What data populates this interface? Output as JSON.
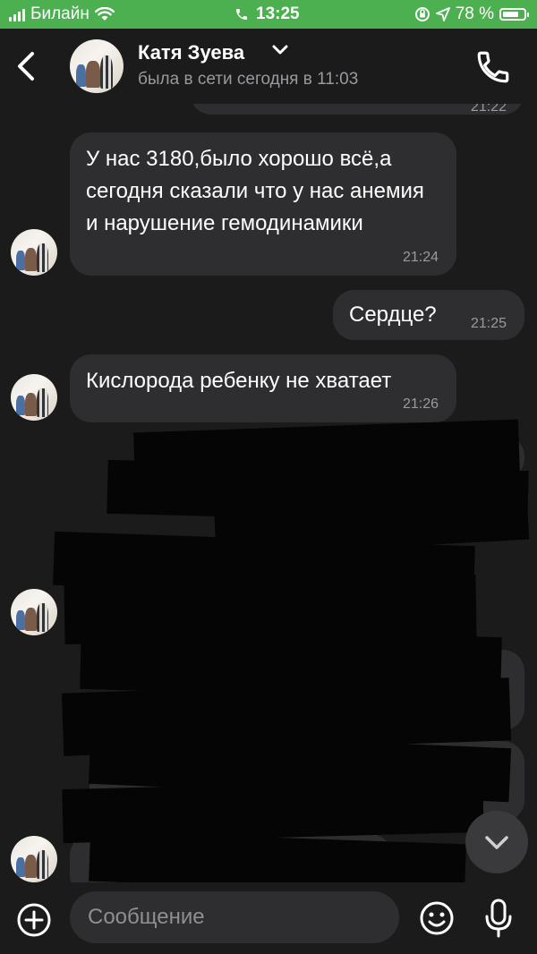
{
  "status_bar": {
    "carrier": "Билайн",
    "time": "13:25",
    "battery": "78 %",
    "battery_level": 0.78
  },
  "header": {
    "contact_name": "Катя Зуева",
    "last_seen": "была в сети сегодня в 11:03",
    "icons": [
      "back-arrow-icon",
      "chevron-down-icon",
      "phone-icon"
    ]
  },
  "messages": [
    {
      "direction": "outgoing",
      "text": "",
      "time": "21:22",
      "partially_visible": true
    },
    {
      "direction": "incoming",
      "text": "У нас 3180,было хорошо всё,а сегодня сказали что у нас анемия и нарушение гемодинамики",
      "time": "21:24"
    },
    {
      "direction": "outgoing",
      "text": "Сердце?",
      "time": "21:25"
    },
    {
      "direction": "incoming",
      "text": "Кислорода ребенку не хватает",
      "time": "21:26"
    }
  ],
  "redacted_note": "",
  "input_bar": {
    "placeholder": "Сообщение",
    "icons": [
      "plus-icon",
      "emoji-icon",
      "microphone-icon"
    ]
  },
  "colors": {
    "background": "#1b1b1c",
    "bubble": "#2e2e30",
    "status_bar": "#4caf50",
    "secondary_text": "#9a9a9e"
  }
}
